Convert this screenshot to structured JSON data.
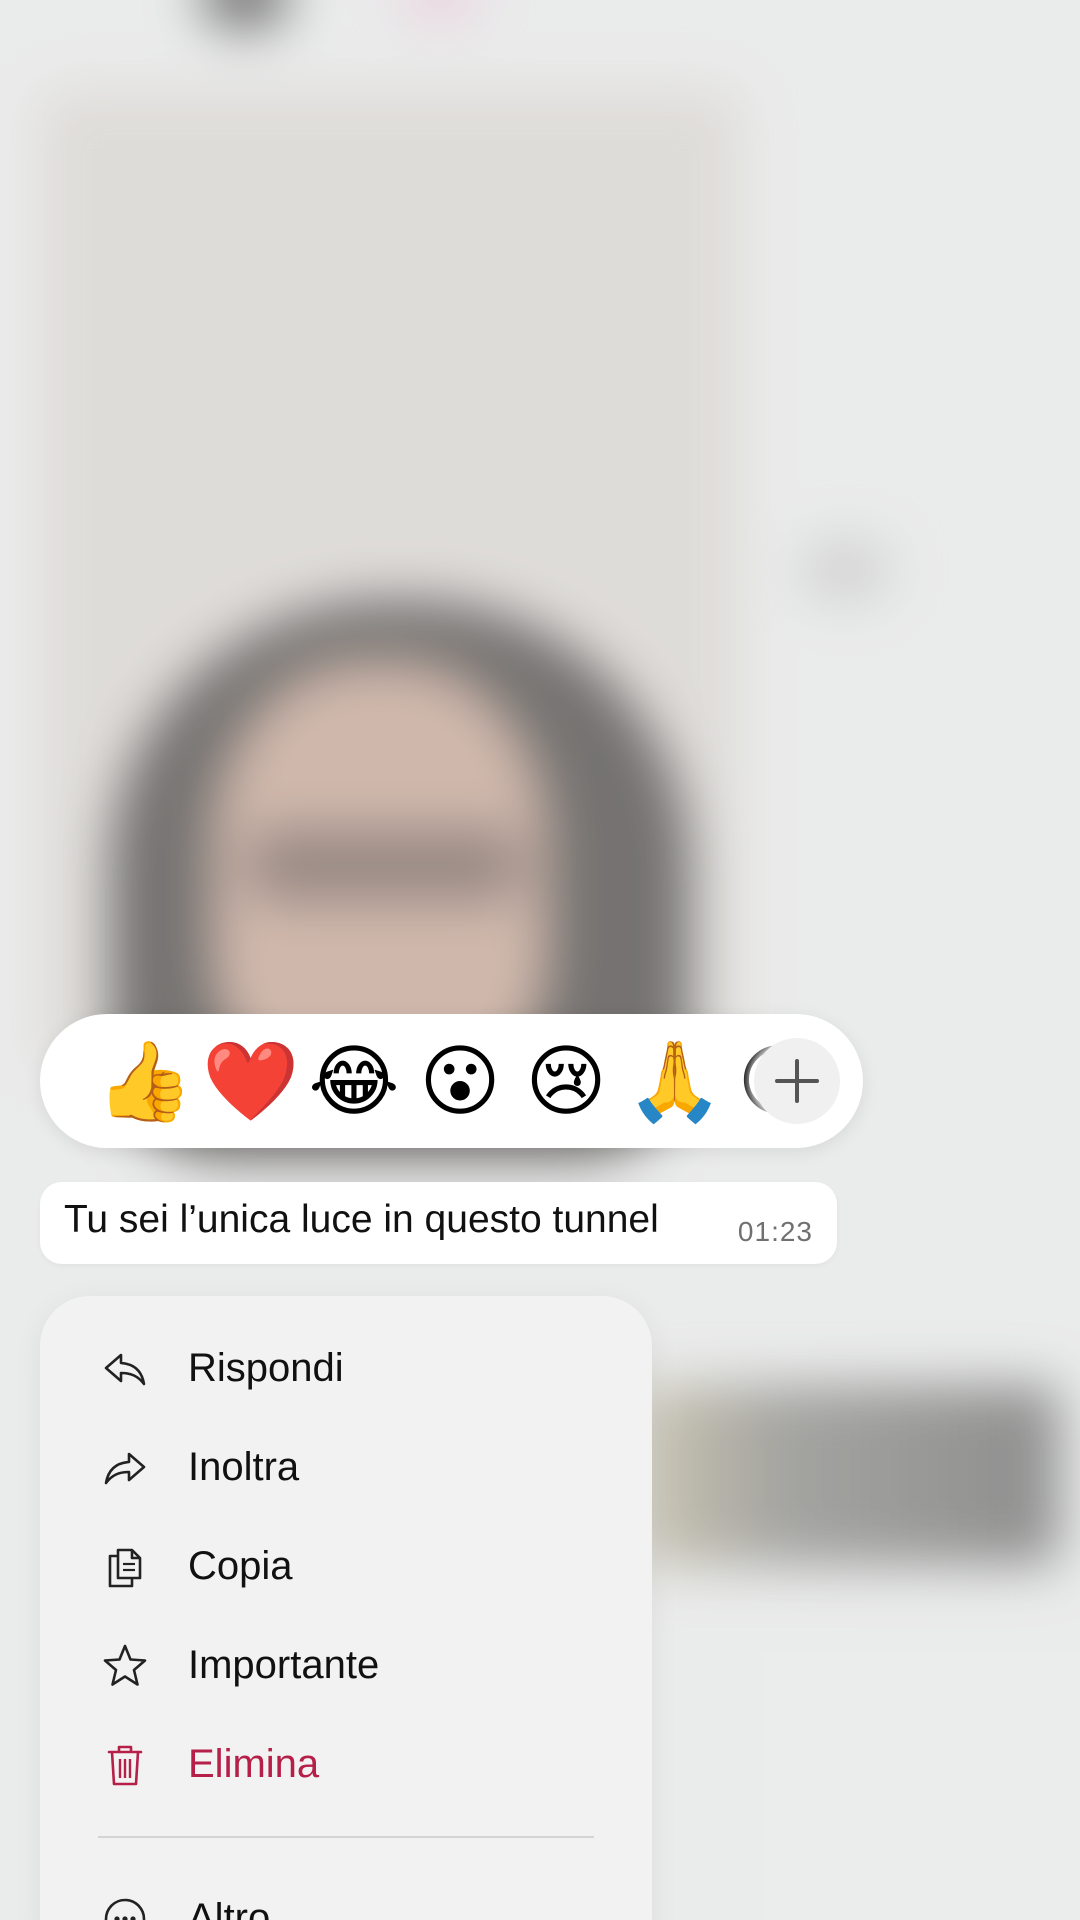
{
  "reactions": {
    "emojis": [
      "👍",
      "❤️",
      "😂",
      "😮",
      "😢",
      "🙏",
      "😍"
    ],
    "more_icon": "plus-icon"
  },
  "message": {
    "text": "Tu sei l’unica luce in questo tunnel",
    "time": "01:23"
  },
  "menu": {
    "items": [
      {
        "label": "Rispondi",
        "icon": "reply-icon"
      },
      {
        "label": "Inoltra",
        "icon": "forward-icon"
      },
      {
        "label": "Copia",
        "icon": "copy-icon"
      },
      {
        "label": "Importante",
        "icon": "star-icon"
      },
      {
        "label": "Elimina",
        "icon": "trash-icon",
        "color": "#b51f48"
      },
      {
        "label": "Altro",
        "icon": "more-circle-icon"
      }
    ]
  },
  "colors": {
    "danger": "#b51f48",
    "icon": "#222222"
  }
}
